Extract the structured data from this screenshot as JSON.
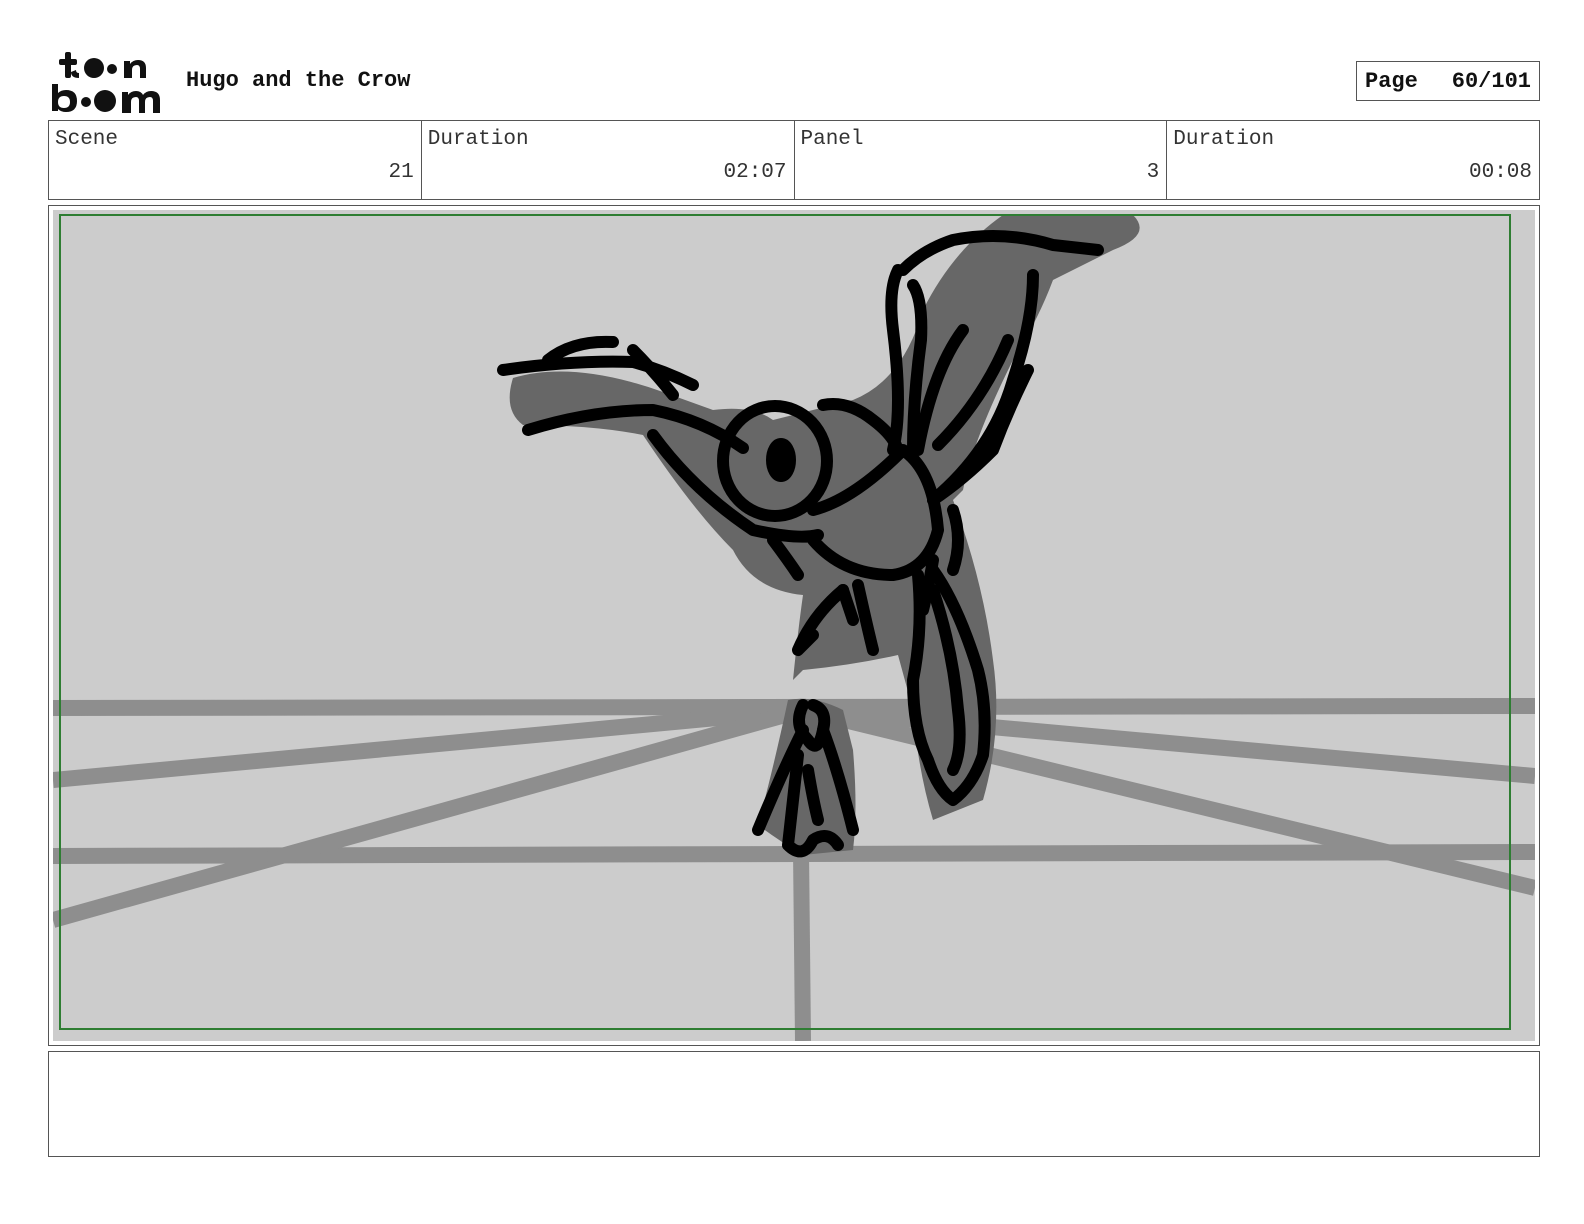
{
  "header": {
    "logo": {
      "icon": "toon-boom-logo",
      "text": "toon boom"
    },
    "project_title": "Hugo and the Crow",
    "page": {
      "label": "Page",
      "value": "60/101"
    }
  },
  "info": {
    "scene": {
      "label": "Scene",
      "value": "21"
    },
    "scene_duration": {
      "label": "Duration",
      "value": "02:07"
    },
    "panel": {
      "label": "Panel",
      "value": "3"
    },
    "panel_duration": {
      "label": "Duration",
      "value": "00:08"
    }
  },
  "panel_image": {
    "subject": "rough sketch of a crow in flight with a figure below",
    "colors": {
      "background": "#cccccc",
      "guides": "#8e8e8e",
      "fill": "#676767",
      "ink": "#000000",
      "safe_frame": "#2e7d32"
    }
  },
  "notes": {
    "text": ""
  }
}
